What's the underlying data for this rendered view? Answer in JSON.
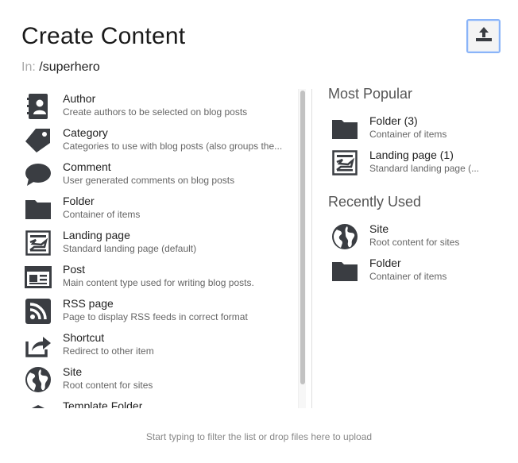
{
  "title": "Create Content",
  "location": {
    "prefix": "In:",
    "path": "/superhero"
  },
  "content_types": [
    {
      "name": "Author",
      "description": "Create authors to be selected on blog posts",
      "icon": "author-icon"
    },
    {
      "name": "Category",
      "description": "Categories to use with blog posts (also groups the...",
      "icon": "tag-icon"
    },
    {
      "name": "Comment",
      "description": "User generated comments on blog posts",
      "icon": "comment-icon"
    },
    {
      "name": "Folder",
      "description": "Container of items",
      "icon": "folder-icon"
    },
    {
      "name": "Landing page",
      "description": "Standard landing page (default)",
      "icon": "landing-page-icon"
    },
    {
      "name": "Post",
      "description": "Main content type used for writing blog posts.",
      "icon": "post-icon"
    },
    {
      "name": "RSS page",
      "description": "Page to display RSS feeds in correct format",
      "icon": "rss-icon"
    },
    {
      "name": "Shortcut",
      "description": "Redirect to other item",
      "icon": "shortcut-icon"
    },
    {
      "name": "Site",
      "description": "Root content for sites",
      "icon": "globe-icon"
    },
    {
      "name": "Template Folder",
      "description": "",
      "icon": "template-folder-icon"
    }
  ],
  "most_popular": {
    "heading": "Most Popular",
    "items": [
      {
        "name": "Folder (3)",
        "description": "Container of items",
        "icon": "folder-icon"
      },
      {
        "name": "Landing page (1)",
        "description": "Standard landing page (...",
        "icon": "landing-page-icon"
      }
    ]
  },
  "recently_used": {
    "heading": "Recently Used",
    "items": [
      {
        "name": "Site",
        "description": "Root content for sites",
        "icon": "globe-icon"
      },
      {
        "name": "Folder",
        "description": "Container of items",
        "icon": "folder-icon"
      }
    ]
  },
  "footer_hint": "Start typing to filter the list or drop files here to upload",
  "upload_button": {
    "icon": "upload-icon"
  },
  "colors": {
    "icon": "#3a3d42",
    "accent_border": "#8ab4f8"
  }
}
